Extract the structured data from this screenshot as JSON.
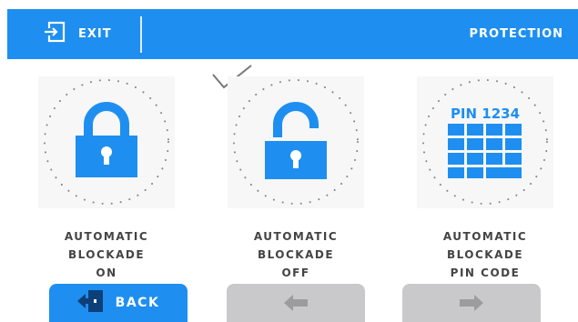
{
  "header": {
    "exit_label": "EXIT",
    "title": "PROTECTION"
  },
  "options": [
    {
      "id": "on",
      "caption": [
        "AUTOMATIC",
        "BLOCKADE",
        "ON"
      ],
      "icon": "lock-closed-icon",
      "selected": false
    },
    {
      "id": "off",
      "caption": [
        "AUTOMATIC",
        "BLOCKADE",
        "OFF"
      ],
      "icon": "lock-open-icon",
      "selected": true
    },
    {
      "id": "pin",
      "caption": [
        "AUTOMATIC",
        "BLOCKADE",
        "PIN CODE"
      ],
      "icon": "keypad-icon",
      "pin_label": "PIN 1234",
      "selected": false
    }
  ],
  "footer": {
    "back_label": "BACK",
    "prev_icon": "arrow-left-icon",
    "next_icon": "arrow-right-icon"
  },
  "colors": {
    "accent": "#1e8ff0",
    "disabled": "#c9c9cb",
    "text": "#444444"
  }
}
